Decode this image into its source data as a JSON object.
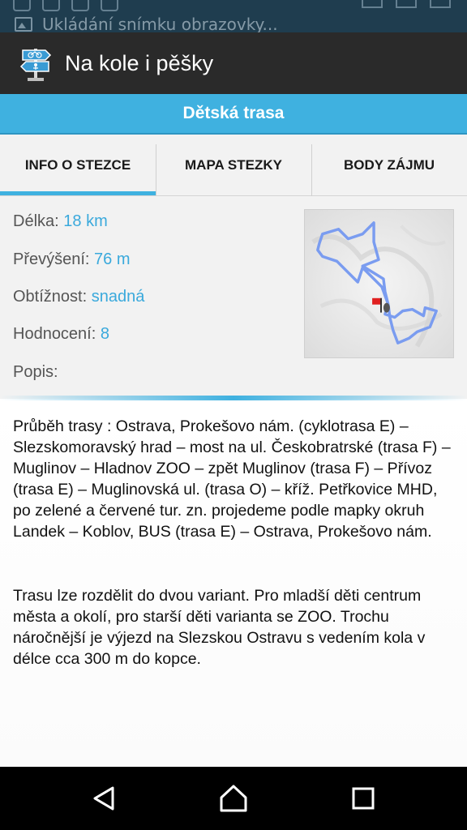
{
  "status_bar": {
    "notification": "Ukládání snímku obrazovky..."
  },
  "app": {
    "title": "Na kole i pěšky"
  },
  "route": {
    "title": "Dětská trasa"
  },
  "tabs": [
    {
      "label": "INFO O STEZCE",
      "active": true
    },
    {
      "label": "MAPA STEZKY",
      "active": false
    },
    {
      "label": "BODY ZÁJMU",
      "active": false
    }
  ],
  "info": {
    "length_label": "Délka:",
    "length_value": "18 km",
    "elevation_label": "Převýšení:",
    "elevation_value": "76 m",
    "difficulty_label": "Obtížnost:",
    "difficulty_value": "snadná",
    "rating_label": "Hodnocení:",
    "rating_value": "8",
    "description_label": "Popis:"
  },
  "description": {
    "paragraph1": "Průběh trasy : Ostrava, Prokešovo nám. (cyklotrasa E) – Slezskomoravský hrad – most na ul. Českobratrské (trasa F) – Muglinov – Hladnov ZOO – zpět Muglinov (trasa F) – Přívoz (trasa E) – Muglinovská ul. (trasa O) – kříž. Petřkovice MHD, po zelené a červené tur. zn. projedeme podle mapky okruh Landek – Koblov, BUS (trasa E) – Ostrava, Prokešovo nám.",
    "paragraph2": "Trasu lze rozdělit do dvou variant. Pro mladší děti centrum města a okolí, pro starší děti varianta se ZOO. Trochu náročnější je výjezd na Slezskou Ostravu s vedením kola v délce cca 300 m do kopce."
  },
  "colors": {
    "accent": "#3fb1e0",
    "app_bar": "#2a2a2a",
    "value_text": "#3aa9dc",
    "route_line": "#7a9cf0",
    "flag": "#e02020"
  }
}
